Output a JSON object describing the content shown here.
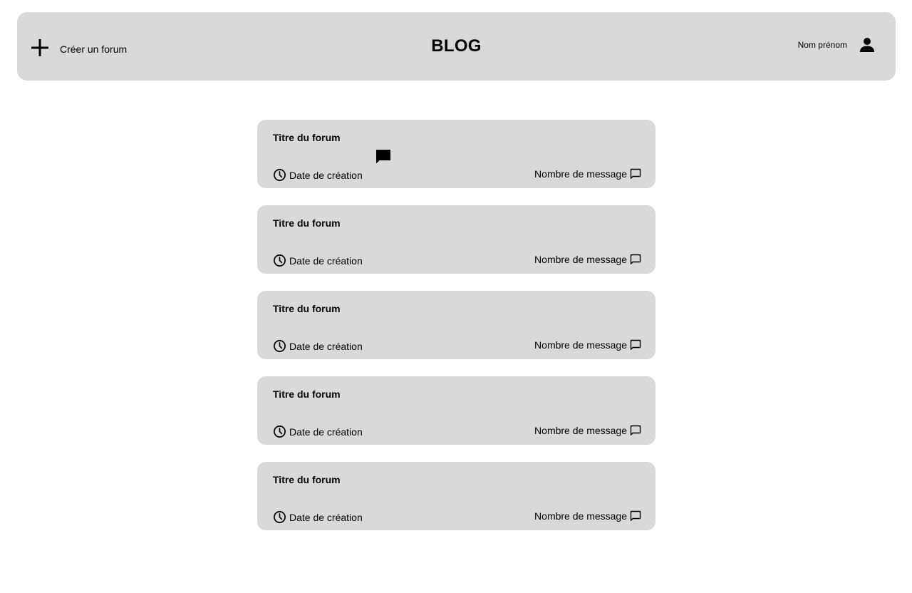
{
  "header": {
    "create_label": "Créer un forum",
    "title": "BLOG",
    "user_name": "Nom prénom"
  },
  "forums": [
    {
      "title": "Titre du forum",
      "date": "Date de création",
      "messages": "Nombre de message"
    },
    {
      "title": "Titre du forum",
      "date": "Date de création",
      "messages": "Nombre de message"
    },
    {
      "title": "Titre du forum",
      "date": "Date de création",
      "messages": "Nombre de message"
    },
    {
      "title": "Titre du forum",
      "date": "Date de création",
      "messages": "Nombre de message"
    },
    {
      "title": "Titre du forum",
      "date": "Date de création",
      "messages": "Nombre de message"
    }
  ],
  "icons": {
    "create": "plus-icon",
    "user": "user-icon",
    "date": "clock-icon",
    "messages": "chat-bubble-icon",
    "floating": "chat-bubble-filled-icon"
  },
  "colors": {
    "panel": "#d9d9d9",
    "background": "#ffffff",
    "text": "#000000"
  }
}
